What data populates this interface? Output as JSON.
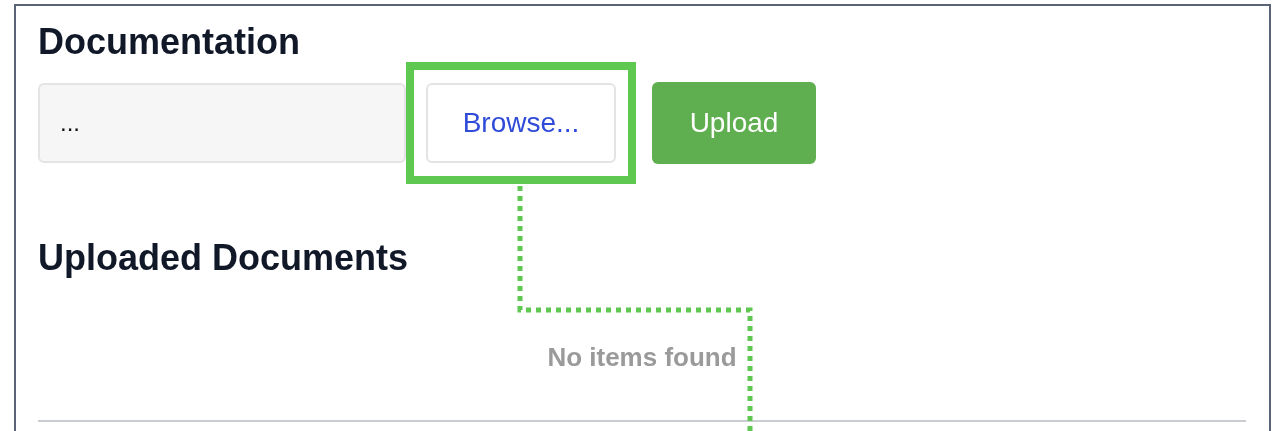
{
  "section": {
    "title": "Documentation"
  },
  "file_input": {
    "value": "..."
  },
  "buttons": [
    {
      "kind": "browse",
      "label": "Browse...",
      "highlighted": true
    },
    {
      "kind": "upload",
      "label": "Upload",
      "highlighted": false
    }
  ],
  "uploaded": {
    "title": "Uploaded Documents",
    "empty_text": "No items found"
  }
}
